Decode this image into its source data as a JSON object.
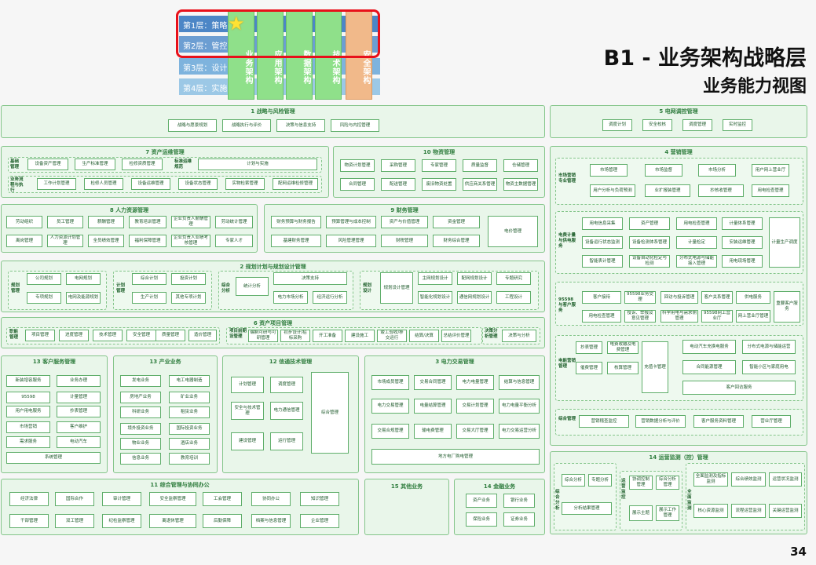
{
  "header": {
    "layers": [
      "第1层：策略",
      "第2层：管控",
      "第3层：设计",
      "第4层：实施"
    ],
    "columns": [
      "业务架构",
      "应用架构",
      "数据架构",
      "技术架构",
      "安全架构"
    ],
    "star_icon": "★",
    "title_main": "B1 - 业务架构战略层",
    "title_sub": "业务能力视图",
    "page_number": "34"
  },
  "colors": {
    "accent": "#e8101a",
    "green": "#8fe08a",
    "orange": "#f1b98a",
    "panel_bg": "#e9f6ea",
    "panel_border": "#84c58a"
  },
  "panels": {
    "strategy": {
      "title": "1 战略与风险管理",
      "items": [
        "战略与愿景规划",
        "战略执行与评价",
        "决策与信息支持",
        "风险与内控管理"
      ]
    },
    "power_dispatch": {
      "title": "5 电网调控管理",
      "items": [
        "调度计划",
        "安全校核",
        "调度管理",
        "实时监控"
      ]
    },
    "asset_ops": {
      "title": "7 资产运维管理",
      "rows": [
        {
          "side": "基础管理",
          "items": [
            "设备资产管理",
            "生产标准管理",
            "检修资质管理"
          ],
          "side2": "标准运维规范",
          "wide": "计划与实施"
        },
        {
          "side": "业务流程与执行",
          "items": [
            "工作计划管理",
            "检修人员管理",
            "设备运维管理",
            "设备状态管理",
            "实物检索管理",
            "配网运维检修管理"
          ]
        }
      ]
    },
    "materials": {
      "title": "10 物资管理",
      "items": [
        "物资计划管理",
        "采购管理",
        "专家管理",
        "质量监督",
        "仓储管理",
        "合同管理",
        "配送管理",
        "废旧物资处置",
        "供应商关系管理",
        "物资主数据管理"
      ]
    },
    "hr": {
      "title": "8 人力资源管理",
      "items": [
        "劳动组织",
        "员工管理",
        "薪酬管理",
        "教育培训管理",
        "企业负责人薪酬管理",
        "劳动统计管理",
        "离岗管理",
        "人力资源计划管理",
        "全员绩效管理",
        "福利保障管理",
        "企业负责人业绩考核管理",
        "专家人才"
      ]
    },
    "finance": {
      "title": "9 财务管理",
      "items": [
        "财务预算与财务报告",
        "预算管理与成本控制",
        "资产与价值管理",
        "资金管理",
        "电价管理",
        "基建财务管理",
        "风险管理管理",
        "财税管理",
        "财务综合管理"
      ]
    },
    "planning": {
      "title": "2 规划计划与规划设计管理",
      "groups": [
        {
          "side": "规划管理",
          "items": [
            "公司规划",
            "电网规划",
            "专项规划",
            "电网及能源规划"
          ]
        },
        {
          "side": "计划管理",
          "items": [
            "综合计划",
            "投资计划",
            "生产计划",
            "其他专项计划"
          ]
        },
        {
          "side": "综合分析",
          "items": [
            "统计分析",
            "决策支持",
            "电力市场分析",
            "经济运行分析"
          ]
        },
        {
          "side": "规划设计",
          "items": [
            "规划设计管理",
            "主网规划设计",
            "配网规划设计",
            "专题研究",
            "智能化规划设计",
            "通信网规划设计",
            "工程设计"
          ]
        }
      ]
    },
    "project": {
      "title": "6 资产项目管理",
      "side1": "职能管理",
      "items1": [
        "项目管理",
        "进度管理",
        "技术管理",
        "安全管理",
        "质量管理",
        "造价管理"
      ],
      "side2": "项目前期设管理",
      "items2": [
        "编制可研与可研管理",
        "初步设计/招标采购",
        "开工准备",
        "建设施工",
        "竣工验收/移交运行",
        "结算/决算",
        "总结评价管理"
      ],
      "side3": "决策分析管理",
      "item3": "决策与分析"
    },
    "customer": {
      "title": "13 客户服务管理",
      "items": [
        "新装增容服务",
        "业务办理",
        "95598",
        "计量管理",
        "用户用电服务",
        "抄表管理",
        "市场营销",
        "客户维护",
        "需求服务",
        "电动汽车",
        "系统管理"
      ]
    },
    "industry": {
      "title": "13 产业业务",
      "items": [
        "发电业务",
        "电工电器制造",
        "房地产业务",
        "矿业业务",
        "科研业务",
        "租赁业务",
        "境外投资业务",
        "国际投资业务",
        "物业业务",
        "酒店业务",
        "信息业务",
        "教育培训"
      ]
    },
    "info_tech": {
      "title": "12 信通技术管理",
      "items": [
        "计划管理",
        "调度管理",
        "安全与技术管理",
        "电力通信管理",
        "建设管理",
        "运行管理",
        "综合管理"
      ]
    },
    "power_trade": {
      "title": "3 电力交易管理",
      "items": [
        "市场成员管理",
        "交易合同管理",
        "电力电量管理",
        "结算与信息管理",
        "电力交易管理",
        "电量结算管理",
        "交易计划管理",
        "电力电量平衡分析",
        "交易合规管理",
        "输电费管理",
        "交易大厅管理",
        "电力交易运营分析",
        "地方电厂购电管理"
      ]
    },
    "marketing": {
      "title": "4 营销管理",
      "groups": [
        {
          "side": "市场营销专业管理",
          "items": [
            "市场管理",
            "市场监督",
            "市场分析",
            "用户网上营业厅",
            "用户分析与负荷预测",
            "业扩报装管理",
            "抄核收管理",
            "用电检查管理"
          ]
        },
        {
          "side": "电费计量与供电服务",
          "items": [
            "用电信息采集",
            "资产管理",
            "用电检查管理",
            "计量体系管理",
            "计量生产调度",
            "设备运行状态监测",
            "设备检测体系管理",
            "计量检定",
            "安装运维管理",
            "智能表计管理",
            "设备自动化检定与检测",
            "分布式电源与储能接入管理",
            "用电现场管理"
          ]
        },
        {
          "side": "95598与客户服务",
          "items": [
            "客户接待",
            "95598业务受理",
            "回访与投诉管理",
            "客户关系管理",
            "供电服务",
            "重要客户服务",
            "用电检查管理",
            "投诉、举报及意见管理",
            "科学用电与需求侧管理",
            "95598网上营业厅",
            "网上营业厅管理"
          ]
        },
        {
          "side": "电能营销管理",
          "items": [
            "抄表管理",
            "电费收缴及电费管理",
            "核算管理",
            "充值卡管理",
            "催费管理",
            "电动汽车充换电服务",
            "分布式电源与储能运营",
            "合同能源管理",
            "智能小区与家庭用电",
            "客户回访服务"
          ]
        },
        {
          "side": "综合管理",
          "items": [
            "营销稽查监控",
            "营销数据分析与评价",
            "客户服务资料管理",
            "营业厅管理"
          ]
        }
      ]
    },
    "ops_monitor": {
      "title": "14 运营监测（控）管理",
      "groups": [
        {
          "side": "综合分析",
          "items": [
            "综合分析",
            "专题分析",
            "分析结果管理"
          ]
        },
        {
          "side": "运营监控",
          "items": [
            "协调控制管理",
            "综合分析管理",
            "展示主题",
            "展示工作管理"
          ]
        },
        {
          "side": "全面监测",
          "items": [
            "全面监测及指标监测",
            "综合绩效监测",
            "运营状况监测",
            "核心资源监测",
            "流程运营监测",
            "关键运营监测"
          ]
        }
      ]
    },
    "admin": {
      "title": "11 综合管理与协同办公",
      "items": [
        "经济法律",
        "国际合作",
        "审计管理",
        "安全监察管理",
        "工会管理",
        "协同办公",
        "知识管理",
        "干部管理",
        "双工管理",
        "纪检监察管理",
        "离退休管理",
        "后勤保障",
        "档案与信息管理",
        "企业管理"
      ]
    },
    "other": {
      "title": "15 其他业务"
    },
    "financial": {
      "title": "14 金融业务",
      "items": [
        "资产业务",
        "银行业务",
        "保险业务",
        "证券业务"
      ]
    }
  }
}
